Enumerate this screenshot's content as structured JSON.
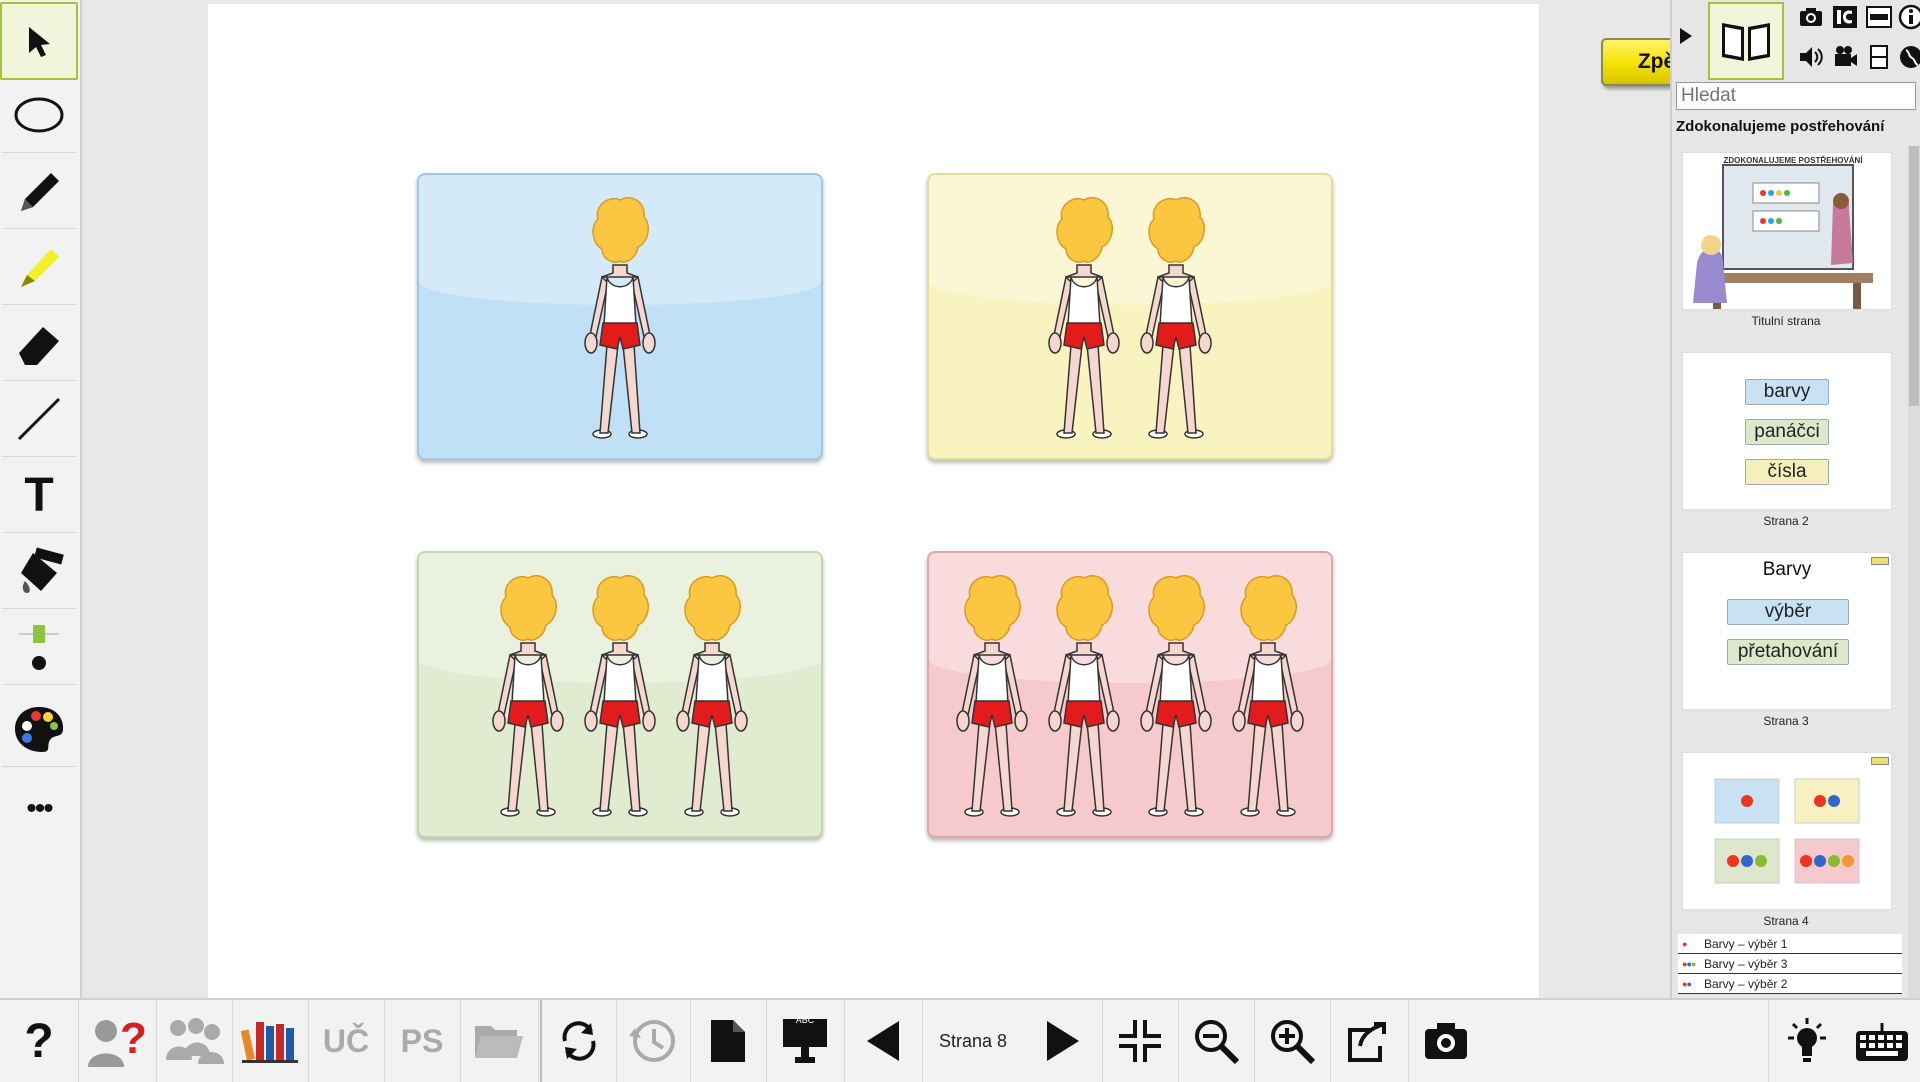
{
  "canvas": {
    "back_button": "Zpět",
    "cards": [
      {
        "color": "#bfe0f5",
        "figures": 1
      },
      {
        "color": "#f9f3bf",
        "figures": 2
      },
      {
        "color": "#e0ebcf",
        "figures": 3
      },
      {
        "color": "#f6c9cd",
        "figures": 4
      }
    ]
  },
  "left_toolbar": {
    "tools": [
      "select-arrow-icon",
      "ellipse-icon",
      "pen-icon",
      "highlighter-icon",
      "eraser-icon",
      "line-icon",
      "text-icon",
      "fill-bucket-icon",
      "line-width-icon",
      "palette-icon",
      "more-icon"
    ],
    "text_tool_glyph": "T",
    "more_glyph": "•••"
  },
  "bottom_toolbar": {
    "help_glyph": "?",
    "uc_label": "UČ",
    "ps_label": "PS",
    "page_label": "Strana 8",
    "abc_label": "ABC"
  },
  "right_panel": {
    "search_placeholder": "Hledat",
    "book_title": "Zdokonalujeme postřehování",
    "thumb1": {
      "caption": "Titulní strana",
      "banner": "ZDOKONALUJEME POSTŘEHOVÁNÍ"
    },
    "thumb2": {
      "caption": "Strana 2",
      "items": [
        "barvy",
        "panáčci",
        "čísla"
      ]
    },
    "thumb3": {
      "caption": "Strana 3",
      "heading": "Barvy",
      "items": [
        "výběr",
        "přetahování"
      ]
    },
    "thumb4": {
      "caption": "Strana 4"
    },
    "subpages": [
      "Barvy – výběr 1",
      "Barvy – výběr 3",
      "Barvy – výběr 2"
    ]
  },
  "colors": {
    "accent": "#9fc43a",
    "back_button": "#f3e100"
  }
}
